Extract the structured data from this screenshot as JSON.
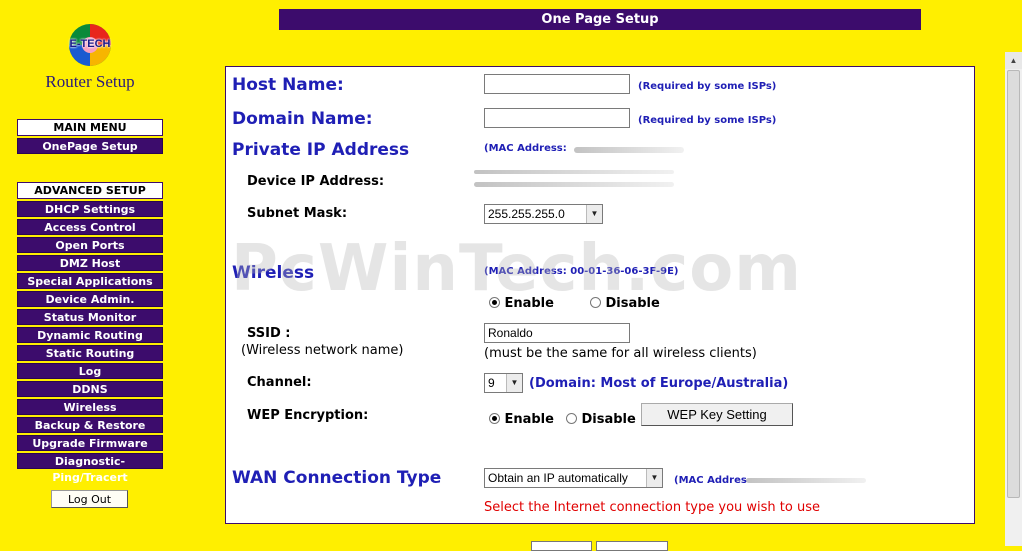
{
  "logo": {
    "brand": "E-TECH",
    "title": "Router Setup"
  },
  "header": {
    "title": "One Page Setup"
  },
  "nav": {
    "main_menu": "MAIN MENU",
    "onepage": "OnePage Setup",
    "advanced": "ADVANCED SETUP",
    "items": [
      "DHCP Settings",
      "Access Control",
      "Open Ports",
      "DMZ Host",
      "Special Applications",
      "Device Admin.",
      "Status Monitor",
      "Dynamic Routing",
      "Static Routing",
      "Log",
      "DDNS",
      "Wireless",
      "Backup & Restore",
      "Upgrade Firmware",
      "Diagnostic-Ping/Tracert"
    ],
    "logout": "Log Out"
  },
  "form": {
    "host_name": {
      "label": "Host Name:",
      "value": "",
      "note": "(Required by some ISPs)"
    },
    "domain_name": {
      "label": "Domain Name:",
      "value": "",
      "note": "(Required by some ISPs)"
    },
    "private_ip": {
      "title": "Private IP Address",
      "mac_note": "(MAC Address:",
      "device_ip_label": "Device IP Address:",
      "subnet_label": "Subnet Mask:",
      "subnet_value": "255.255.255.0"
    },
    "wireless": {
      "title": "Wireless",
      "mac_note": "(MAC Address: 00-01-36-06-3F-9E)",
      "enable": "Enable",
      "disable": "Disable",
      "ssid_label": "SSID :",
      "ssid_sub": "(Wireless network name)",
      "ssid_value": "Ronaldo",
      "ssid_hint": "(must be the same for all wireless clients)",
      "channel_label": "Channel:",
      "channel_value": "9",
      "domain_note": "(Domain: Most of Europe/Australia)",
      "wep_label": "WEP Encryption:",
      "wep_enable": "Enable",
      "wep_disable": "Disable",
      "wep_button": "WEP Key Setting"
    },
    "wan": {
      "title": "WAN Connection Type",
      "select_value": "Obtain an IP automatically",
      "mac_note": "(MAC Addres",
      "hint": "Select the Internet connection type you wish to use"
    }
  },
  "watermark": "PcWinTech.com",
  "colors": {
    "background": "#ffef00",
    "nav": "#3c0c6c",
    "heading": "#1f1fb5",
    "hint": "#e00000"
  }
}
